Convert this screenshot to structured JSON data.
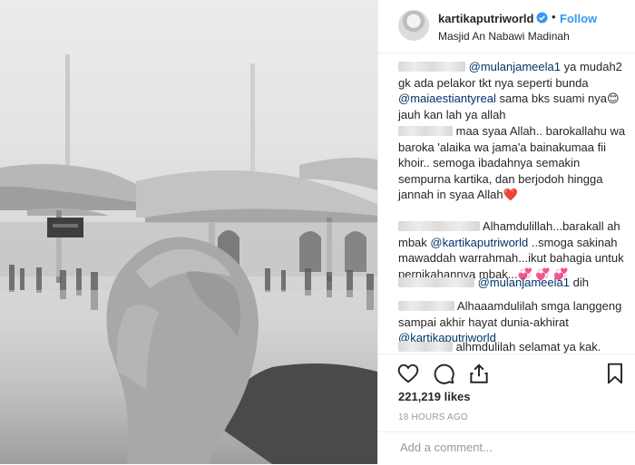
{
  "post": {
    "username": "kartikaputriworld",
    "follow_label": "Follow",
    "location": "Masjid An Nabawi Madinah",
    "likes": "221,219 likes",
    "timestamp": "18 HOURS AGO",
    "comment_placeholder": "Add a comment..."
  },
  "comments": [
    {
      "mention": "@mulanjameela1",
      "t1": " ya mudah2 gk ada pelakor tkt nya seperti bunda ",
      "mention2": "@maiaestiantyreal",
      "t2": " sama bks suami nya",
      "emoji": "😊",
      "t3": " jauh kan lah ya allah"
    },
    {
      "text": "maa syaa Allah.. barokallahu wa baroka 'alaika wa jama'a bainakumaa fii khoir.. semoga ibadahnya semakin sempurna kartika, dan berjodoh hingga jannah in syaa Allah",
      "emoji": "❤️"
    },
    {
      "t1": "Alhamdulillah...barakall ah mbak ",
      "mention": "@kartikaputriworld",
      "t2": " ..smoga sakinah mawaddah warrahmah...ikut bahagia untuk pernikahannya mbak...",
      "emoji": "💞 💞 💞"
    },
    {
      "mention": "@mulanjameela1",
      "text": " dih"
    },
    {
      "text": "Alhaaamdulilah smga langgeng sampai akhir hayat dunia-akhirat ",
      "mention": "@kartikaputriworld"
    },
    {
      "text": "alhmdulilah selamat ya kak."
    }
  ],
  "icons": {
    "like": "heart-outline-icon",
    "comment": "speech-bubble-icon",
    "share": "share-arrow-icon",
    "save": "bookmark-icon",
    "verified": "verified-badge-icon"
  },
  "colors": {
    "link": "#3897f0",
    "mention": "#003569",
    "muted": "#999999"
  }
}
